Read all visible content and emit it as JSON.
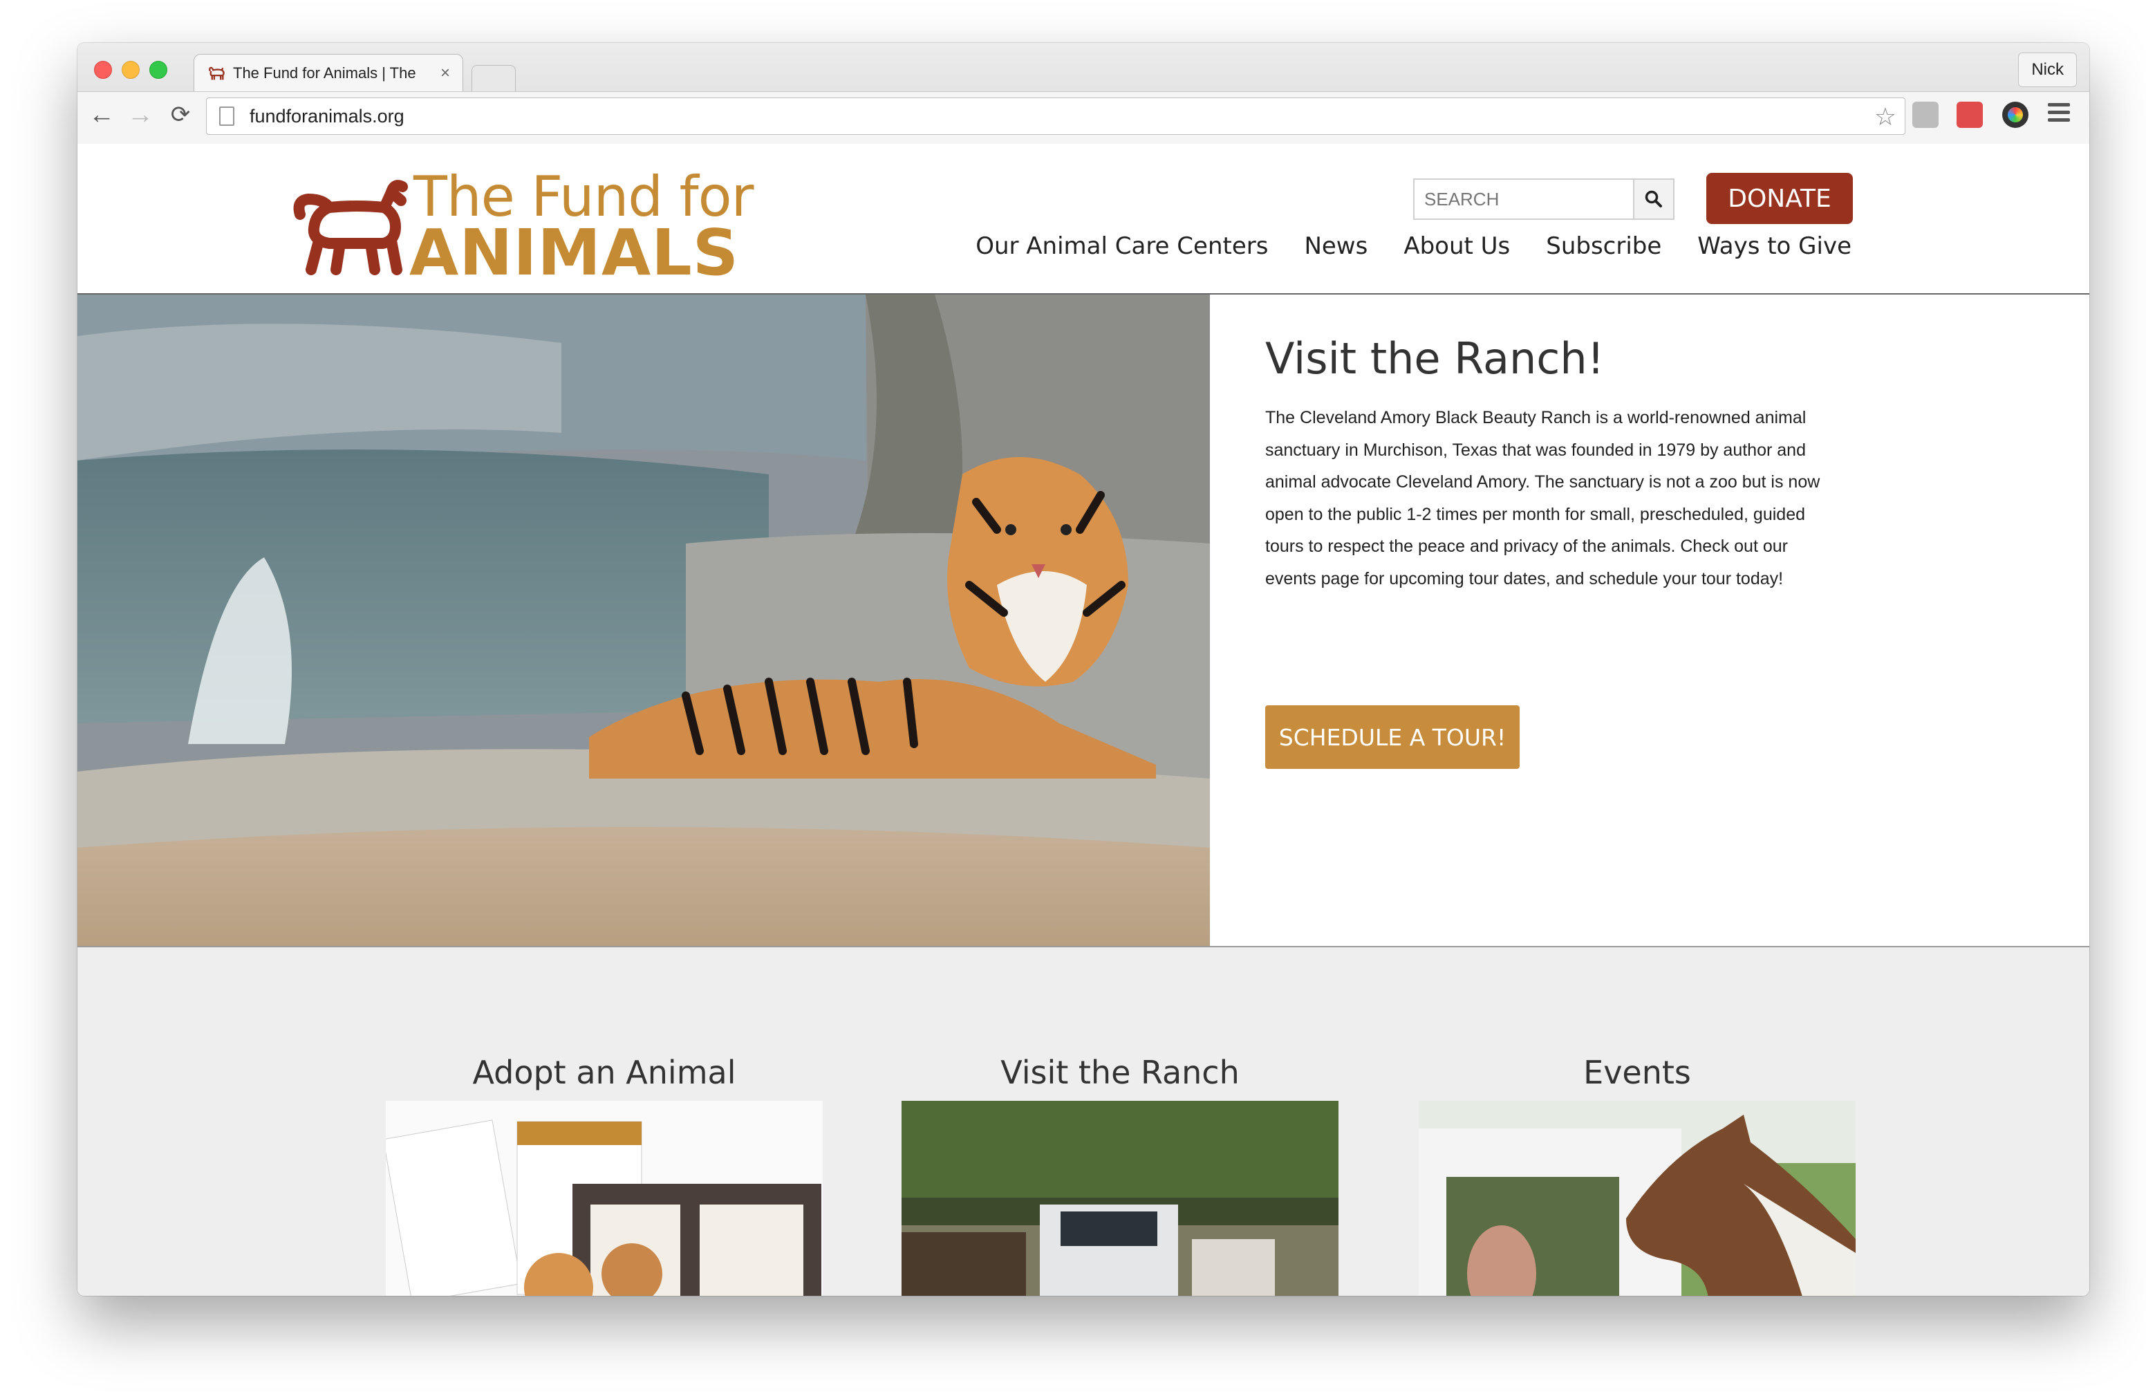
{
  "browser": {
    "tab_title": "The Fund for Animals | The",
    "tab_close": "×",
    "profile_name": "Nick",
    "url": "fundforanimals.org",
    "back_icon": "←",
    "forward_icon": "→",
    "reload_icon": "⟳",
    "star_icon": "☆"
  },
  "site": {
    "logo_line1": "The Fund for",
    "logo_line2": "ANIMALS",
    "search_placeholder": "SEARCH",
    "donate_label": "DONATE",
    "nav": [
      "Our Animal Care Centers",
      "News",
      "About Us",
      "Subscribe",
      "Ways to Give"
    ]
  },
  "hero": {
    "title": "Visit the Ranch!",
    "body": "The Cleveland Amory Black Beauty Ranch is a world-renowned animal sanctuary in Murchison, Texas that was founded in 1979 by author and animal advocate Cleveland Amory. The sanctuary is not a zoo but is now open to the public 1-2 times per month for small, prescheduled, guided tours to respect the peace and privacy of the animals. Check out our events page for upcoming tour dates, and schedule your tour today!",
    "button_label": "SCHEDULE A TOUR!"
  },
  "features": [
    {
      "title": "Adopt an Animal"
    },
    {
      "title": "Visit the Ranch"
    },
    {
      "title": "Events"
    }
  ],
  "colors": {
    "brand_gold": "#c58b34",
    "brand_red": "#98321f",
    "tour_button": "#c88d3c"
  }
}
